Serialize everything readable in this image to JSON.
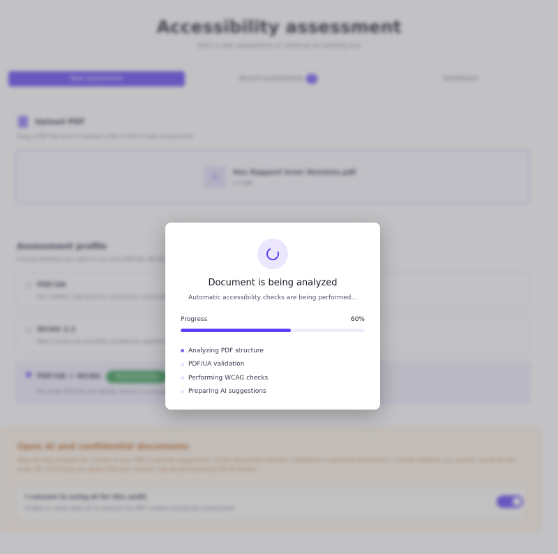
{
  "page": {
    "title": "Accessibility assessment",
    "subtitle": "Start a new assessment or continue an existing one"
  },
  "tabs": [
    {
      "label": "New assessment",
      "active": true
    },
    {
      "label": "Recent assessments",
      "badge": "3"
    },
    {
      "label": "Dashboard"
    }
  ],
  "upload": {
    "title": "Upload PDF",
    "description": "Drag a PDF file here or browse a file to start a new assessment",
    "file_name": "Hes Rapport Inver Revision.pdf",
    "file_size": "2.4 MB",
    "file_icon": "pdf-file-icon"
  },
  "profile": {
    "title": "Assessment profile",
    "description": "Choose whether you want to run only PDF/UA, WCAG or both checks",
    "options": [
      {
        "name": "PDF/UA",
        "description": "ISO 14289-1 standard for universally accessible PDF documents",
        "selected": false
      },
      {
        "name": "WCAG 2.2",
        "description": "Web Content Accessibility Guidelines applied to documents",
        "selected": false
      },
      {
        "name": "PDF/UA + WCAG",
        "badge": "Recommended",
        "description": "Run both PDF/UA and WCAG checks in a single assessment",
        "selected": true
      }
    ]
  },
  "ai": {
    "title": "Open AI and confidential documents",
    "text": "Open AI may analyze the content of your PDF to provide suggestions. If your document contains confidential or personal information, consider whether you want to use AI for this audit. By confirming you agree that your content may be processed by the AI service.",
    "consent_title": "I consent to using AI for this audit",
    "consent_desc": "Enable or allow Open AI to analyze the PDF content during the assessment",
    "consent_enabled": true
  },
  "modal": {
    "spinner_icon": "loading-spinner-icon",
    "title": "Document is being analyzed",
    "subtitle": "Automatic accessibility checks are being performed...",
    "progress_label": "Progress",
    "progress_text": "60%",
    "progress_percent": 60,
    "steps": [
      {
        "label": "Analyzing PDF structure",
        "active": true
      },
      {
        "label": "PDF/UA validation",
        "active": false
      },
      {
        "label": "Performing WCAG checks",
        "active": false
      },
      {
        "label": "Preparing AI suggestions",
        "active": false
      }
    ]
  },
  "colors": {
    "accent": "#5b3df5",
    "success": "#2e9a4b",
    "warning_text": "#c4661c",
    "warning_bg": "#fff6ea"
  }
}
